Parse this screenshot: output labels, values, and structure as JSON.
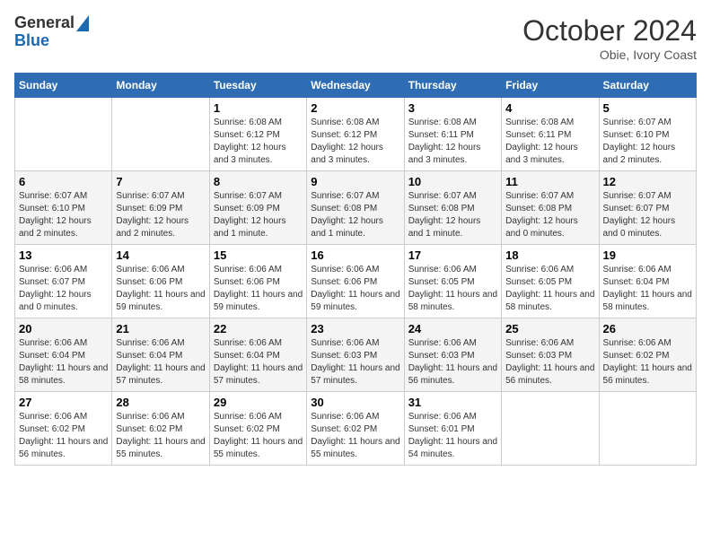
{
  "header": {
    "logo_general": "General",
    "logo_blue": "Blue",
    "month_title": "October 2024",
    "location": "Obie, Ivory Coast"
  },
  "days_of_week": [
    "Sunday",
    "Monday",
    "Tuesday",
    "Wednesday",
    "Thursday",
    "Friday",
    "Saturday"
  ],
  "weeks": [
    [
      {
        "day": "",
        "info": ""
      },
      {
        "day": "",
        "info": ""
      },
      {
        "day": "1",
        "info": "Sunrise: 6:08 AM\nSunset: 6:12 PM\nDaylight: 12 hours and 3 minutes."
      },
      {
        "day": "2",
        "info": "Sunrise: 6:08 AM\nSunset: 6:12 PM\nDaylight: 12 hours and 3 minutes."
      },
      {
        "day": "3",
        "info": "Sunrise: 6:08 AM\nSunset: 6:11 PM\nDaylight: 12 hours and 3 minutes."
      },
      {
        "day": "4",
        "info": "Sunrise: 6:08 AM\nSunset: 6:11 PM\nDaylight: 12 hours and 3 minutes."
      },
      {
        "day": "5",
        "info": "Sunrise: 6:07 AM\nSunset: 6:10 PM\nDaylight: 12 hours and 2 minutes."
      }
    ],
    [
      {
        "day": "6",
        "info": "Sunrise: 6:07 AM\nSunset: 6:10 PM\nDaylight: 12 hours and 2 minutes."
      },
      {
        "day": "7",
        "info": "Sunrise: 6:07 AM\nSunset: 6:09 PM\nDaylight: 12 hours and 2 minutes."
      },
      {
        "day": "8",
        "info": "Sunrise: 6:07 AM\nSunset: 6:09 PM\nDaylight: 12 hours and 1 minute."
      },
      {
        "day": "9",
        "info": "Sunrise: 6:07 AM\nSunset: 6:08 PM\nDaylight: 12 hours and 1 minute."
      },
      {
        "day": "10",
        "info": "Sunrise: 6:07 AM\nSunset: 6:08 PM\nDaylight: 12 hours and 1 minute."
      },
      {
        "day": "11",
        "info": "Sunrise: 6:07 AM\nSunset: 6:08 PM\nDaylight: 12 hours and 0 minutes."
      },
      {
        "day": "12",
        "info": "Sunrise: 6:07 AM\nSunset: 6:07 PM\nDaylight: 12 hours and 0 minutes."
      }
    ],
    [
      {
        "day": "13",
        "info": "Sunrise: 6:06 AM\nSunset: 6:07 PM\nDaylight: 12 hours and 0 minutes."
      },
      {
        "day": "14",
        "info": "Sunrise: 6:06 AM\nSunset: 6:06 PM\nDaylight: 11 hours and 59 minutes."
      },
      {
        "day": "15",
        "info": "Sunrise: 6:06 AM\nSunset: 6:06 PM\nDaylight: 11 hours and 59 minutes."
      },
      {
        "day": "16",
        "info": "Sunrise: 6:06 AM\nSunset: 6:06 PM\nDaylight: 11 hours and 59 minutes."
      },
      {
        "day": "17",
        "info": "Sunrise: 6:06 AM\nSunset: 6:05 PM\nDaylight: 11 hours and 58 minutes."
      },
      {
        "day": "18",
        "info": "Sunrise: 6:06 AM\nSunset: 6:05 PM\nDaylight: 11 hours and 58 minutes."
      },
      {
        "day": "19",
        "info": "Sunrise: 6:06 AM\nSunset: 6:04 PM\nDaylight: 11 hours and 58 minutes."
      }
    ],
    [
      {
        "day": "20",
        "info": "Sunrise: 6:06 AM\nSunset: 6:04 PM\nDaylight: 11 hours and 58 minutes."
      },
      {
        "day": "21",
        "info": "Sunrise: 6:06 AM\nSunset: 6:04 PM\nDaylight: 11 hours and 57 minutes."
      },
      {
        "day": "22",
        "info": "Sunrise: 6:06 AM\nSunset: 6:04 PM\nDaylight: 11 hours and 57 minutes."
      },
      {
        "day": "23",
        "info": "Sunrise: 6:06 AM\nSunset: 6:03 PM\nDaylight: 11 hours and 57 minutes."
      },
      {
        "day": "24",
        "info": "Sunrise: 6:06 AM\nSunset: 6:03 PM\nDaylight: 11 hours and 56 minutes."
      },
      {
        "day": "25",
        "info": "Sunrise: 6:06 AM\nSunset: 6:03 PM\nDaylight: 11 hours and 56 minutes."
      },
      {
        "day": "26",
        "info": "Sunrise: 6:06 AM\nSunset: 6:02 PM\nDaylight: 11 hours and 56 minutes."
      }
    ],
    [
      {
        "day": "27",
        "info": "Sunrise: 6:06 AM\nSunset: 6:02 PM\nDaylight: 11 hours and 56 minutes."
      },
      {
        "day": "28",
        "info": "Sunrise: 6:06 AM\nSunset: 6:02 PM\nDaylight: 11 hours and 55 minutes."
      },
      {
        "day": "29",
        "info": "Sunrise: 6:06 AM\nSunset: 6:02 PM\nDaylight: 11 hours and 55 minutes."
      },
      {
        "day": "30",
        "info": "Sunrise: 6:06 AM\nSunset: 6:02 PM\nDaylight: 11 hours and 55 minutes."
      },
      {
        "day": "31",
        "info": "Sunrise: 6:06 AM\nSunset: 6:01 PM\nDaylight: 11 hours and 54 minutes."
      },
      {
        "day": "",
        "info": ""
      },
      {
        "day": "",
        "info": ""
      }
    ]
  ]
}
